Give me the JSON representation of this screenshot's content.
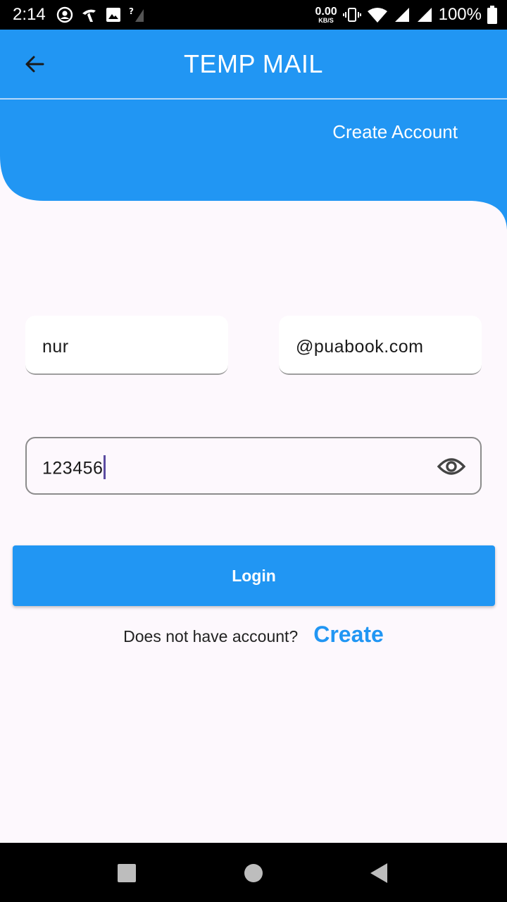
{
  "status_bar": {
    "time": "2:14",
    "net_speed_value": "0.00",
    "net_speed_unit": "KB/S",
    "battery": "100%",
    "icons": [
      "account-circle-icon",
      "carrier-icon",
      "image-icon",
      "no-signal-icon",
      "vibrate-icon",
      "wifi-icon",
      "signal-icon",
      "signal-2-icon",
      "battery-icon"
    ]
  },
  "app_bar": {
    "title": "TEMP MAIL",
    "back_icon": "arrow-left-icon"
  },
  "header": {
    "create_account_label": "Create Account"
  },
  "form": {
    "username_value": "nur",
    "domain_value": "@puabook.com",
    "password_value": "123456",
    "visibility_icon": "eye-icon",
    "login_label": "Login",
    "signup_prompt": "Does not have account?",
    "signup_link": "Create"
  },
  "colors": {
    "primary": "#2196f3",
    "background": "#fdf8fd",
    "caret": "#5b4ba0"
  },
  "nav_bar": {
    "icons": [
      "recents-square-icon",
      "home-circle-icon",
      "back-triangle-icon"
    ]
  }
}
